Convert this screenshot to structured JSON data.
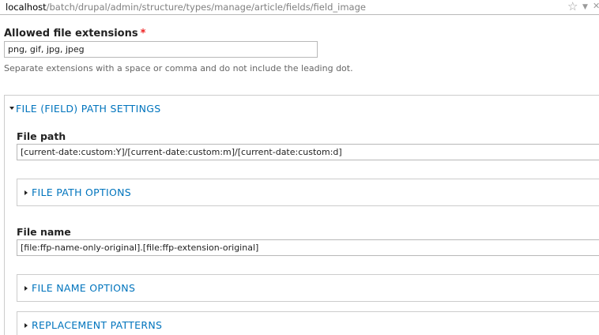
{
  "browser": {
    "url_host": "localhost",
    "url_path": "/batch/drupal/admin/structure/types/manage/article/fields/field_image",
    "icons": [
      "star-icon",
      "dropdown-icon",
      "close-icon"
    ]
  },
  "allowed_extensions": {
    "label": "Allowed file extensions",
    "required_mark": "*",
    "value": "png, gif, jpg, jpeg",
    "description": "Separate extensions with a space or comma and do not include the leading dot."
  },
  "path_settings": {
    "legend": "File (Field) Path settings",
    "file_path": {
      "label": "File path",
      "value": "[current-date:custom:Y]/[current-date:custom:m]/[current-date:custom:d]"
    },
    "file_path_options": "File Path options",
    "file_name": {
      "label": "File name",
      "value": "[file:ffp-name-only-original].[file:ffp-extension-original]"
    },
    "file_name_options": "File Name options",
    "replacement_patterns": "Replacement patterns"
  },
  "colors": {
    "link": "#0074bd",
    "required": "#ee2222",
    "border": "#cccccc"
  }
}
